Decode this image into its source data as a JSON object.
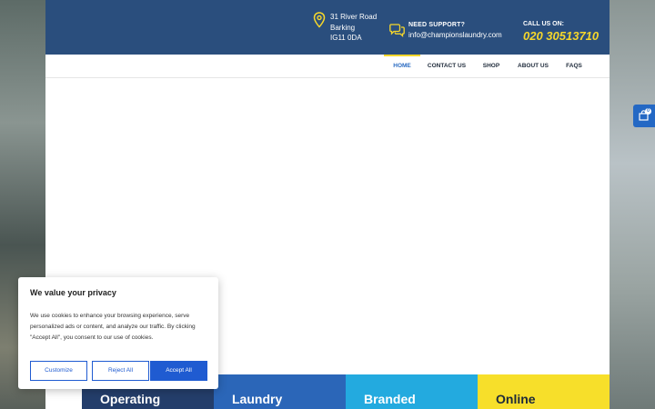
{
  "header": {
    "address_lines": [
      "31 River Road",
      "Barking",
      "IG11 0DA"
    ],
    "support_label": "NEED SUPPORT?",
    "support_email": "info@championslaundry.com",
    "call_label": "CALL US ON:",
    "call_number": "020 30513710",
    "icon_pin": "map-pin-icon",
    "icon_chat": "chat-bubbles-icon"
  },
  "nav": {
    "items": [
      {
        "label": "HOME",
        "active": true
      },
      {
        "label": "CONTACT US",
        "active": false
      },
      {
        "label": "SHOP",
        "active": false
      },
      {
        "label": "ABOUT US",
        "active": false
      },
      {
        "label": "FAQS",
        "active": false
      }
    ]
  },
  "tiles": [
    "Operating",
    "Laundry",
    "Branded",
    "Online"
  ],
  "cart": {
    "count": "0",
    "icon": "shopping-bag-icon"
  },
  "cookie": {
    "title": "We value your privacy",
    "body": "We use cookies to enhance your browsing experience, serve personalized ads or content, and analyze our traffic. By clicking \"Accept All\", you consent to our use of cookies.",
    "customize": "Customize",
    "reject": "Reject All",
    "accept": "Accept All"
  },
  "colors": {
    "header_bg": "#2a4e7d",
    "accent_yellow": "#f6d72b",
    "nav_active": "#2a6bc2",
    "button_blue": "#1f5bd1"
  }
}
